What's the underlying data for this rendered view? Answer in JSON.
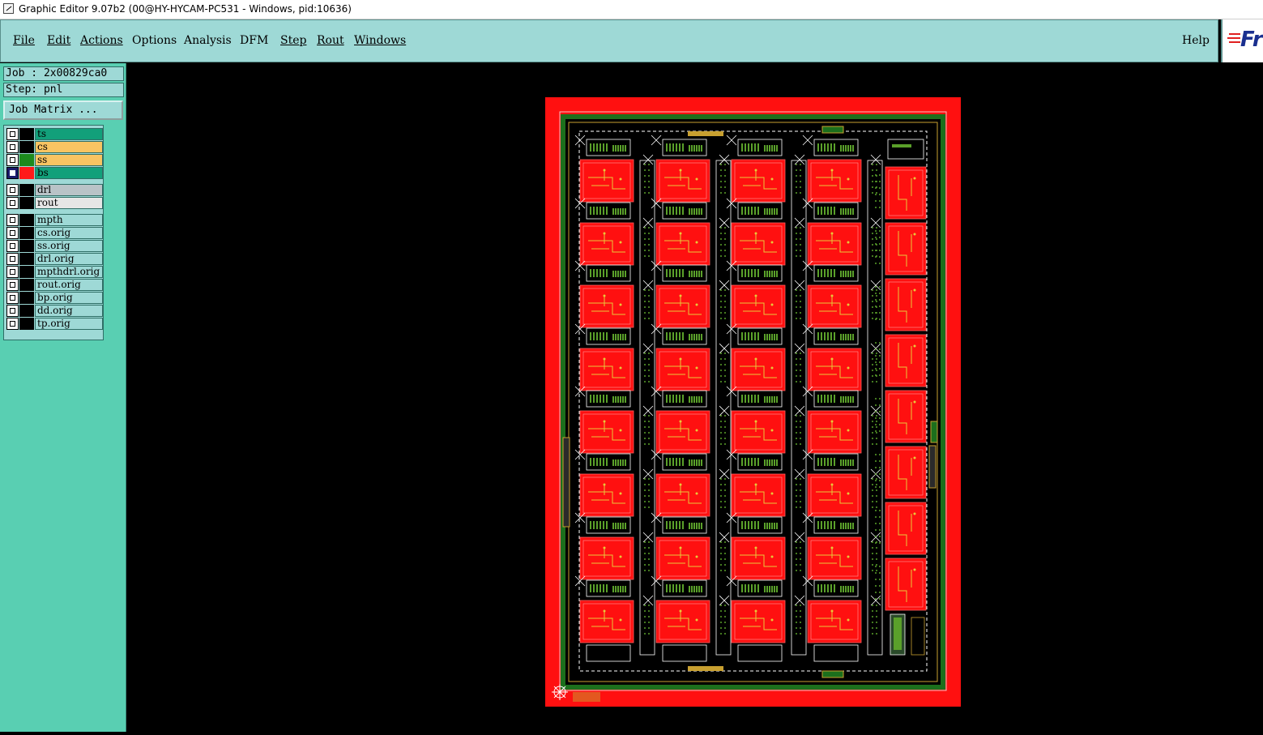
{
  "window": {
    "title": "Graphic Editor 9.07b2 (00@HY-HYCAM-PC531 - Windows, pid:10636)"
  },
  "menu": {
    "items": [
      {
        "label": "File",
        "underline": true
      },
      {
        "label": "Edit",
        "underline": true
      },
      {
        "label": "Actions",
        "underline": true
      },
      {
        "label": "Options",
        "underline": false
      },
      {
        "label": "Analysis",
        "underline": false
      },
      {
        "label": "DFM",
        "underline": false
      },
      {
        "label": "Step",
        "underline": true
      },
      {
        "label": "Rout",
        "underline": true
      },
      {
        "label": "Windows",
        "underline": true
      }
    ],
    "help": "Help",
    "logo": "Fr"
  },
  "sidebar": {
    "job": "Job : 2x00829ca0",
    "step": "Step: pnl",
    "job_matrix_button": "Job Matrix ...",
    "layers": [
      {
        "name": "ts",
        "color": "#000000",
        "bg": "#12a07a",
        "checked": false
      },
      {
        "name": "cs",
        "color": "#000000",
        "bg": "#f8c462",
        "checked": false
      },
      {
        "name": "ss",
        "color": "#1c8a1c",
        "bg": "#f8c462",
        "checked": false
      },
      {
        "name": "bs",
        "color": "#ff1a1a",
        "bg": "#12a07a",
        "checked": true
      },
      {
        "name": "drl",
        "color": "#000000",
        "bg": "#b9c3c7",
        "checked": false
      },
      {
        "name": "rout",
        "color": "#000000",
        "bg": "#e6e6e6",
        "checked": false
      },
      {
        "name": "mpth",
        "color": "#000000",
        "bg": "#9ed9d6",
        "checked": false
      },
      {
        "name": "cs.orig",
        "color": "#000000",
        "bg": "#9ed9d6",
        "checked": false
      },
      {
        "name": "ss.orig",
        "color": "#000000",
        "bg": "#9ed9d6",
        "checked": false
      },
      {
        "name": "drl.orig",
        "color": "#000000",
        "bg": "#9ed9d6",
        "checked": false
      },
      {
        "name": "mpthdrl.orig",
        "color": "#000000",
        "bg": "#9ed9d6",
        "checked": false
      },
      {
        "name": "rout.orig",
        "color": "#000000",
        "bg": "#9ed9d6",
        "checked": false
      },
      {
        "name": "bp.orig",
        "color": "#000000",
        "bg": "#9ed9d6",
        "checked": false
      },
      {
        "name": "dd.orig",
        "color": "#000000",
        "bg": "#9ed9d6",
        "checked": false
      },
      {
        "name": "tp.orig",
        "color": "#000000",
        "bg": "#9ed9d6",
        "checked": false
      }
    ]
  },
  "board": {
    "grid_columns": 4,
    "grid_rows": 8,
    "right_column_boards": 8,
    "colors": {
      "frame": "#ff1010",
      "border": "#1c6f1c",
      "trace": "#e8c83a",
      "line": "#ffffff",
      "background": "#000000"
    }
  }
}
